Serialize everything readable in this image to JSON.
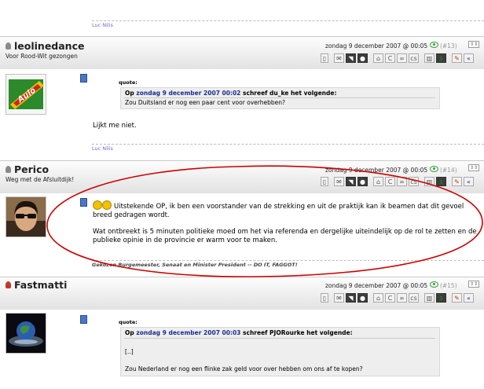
{
  "top_signature": "Luc Nilis",
  "posts": [
    {
      "username": "leolinedance",
      "user_title": "Voor Rood-Wit gezongen",
      "date": "zondag 9 december 2007 @ 00:05",
      "post_number": "(#13)",
      "quote_label": "quote:",
      "quote_header_prefix": "Op",
      "quote_header_date": "zondag 9 december 2007 00:02",
      "quote_header_suffix": "schreef du_ke het volgende:",
      "quote_text": "Zou Duitsland er nog een paar cent voor overhebben?",
      "body": "Lijkt me niet.",
      "signature": "Luc Nilis"
    },
    {
      "username": "Perico",
      "user_title": "Weg met de Afsluitdijk!",
      "date": "zondag 9 december 2007 @ 00:05",
      "post_number": "(#14)",
      "body_line1": "Uitstekende OP, ik ben een voorstander van de strekking en uit de praktijk kan ik beamen dat dit gevoel",
      "body_line2": "breed gedragen wordt.",
      "body_line3": "Wat ontbreekt is 5 minuten politieke moed om het via referenda en dergelijke uiteindelijk op de rol te zetten en de",
      "body_line4": "publieke opinie in de provincie er warm voor te maken.",
      "signature": "Gekozen Burgemeester, Senaat en Minister President -- DO IT, FAGGOT!"
    },
    {
      "username": "Fastmatti",
      "date": "zondag 9 december 2007 @ 00:05",
      "post_number": "(#15)",
      "quote_label": "quote:",
      "quote_header_prefix": "Op",
      "quote_header_date": "zondag 9 december 2007 00:03",
      "quote_header_suffix": "schreef PJORourke het volgende:",
      "quote_text1": "[..]",
      "quote_text2": "Zou Nederland er nog een flinke zak geld voor over hebben om ons af te kopen?"
    }
  ],
  "colors": {
    "link": "#1a2f8c",
    "annotation_ellipse": "#cc0000",
    "eye_icon": "#37a337"
  }
}
